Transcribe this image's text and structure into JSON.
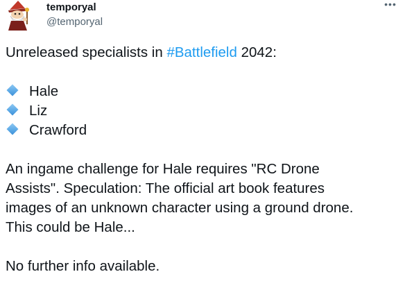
{
  "author": {
    "display_name": "temporyal",
    "handle": "@temporyal",
    "avatar_icon": "cartoon-wizard-avatar"
  },
  "more_icon": "more-horizontal-icon",
  "colors": {
    "hashtag": "#1d9bf0",
    "text": "#0f1419",
    "secondary": "#536471"
  },
  "tweet": {
    "intro_before": "Unreleased specialists in ",
    "hashtag": "#Battlefield",
    "intro_after": " 2042:",
    "bullet_icon": "small-blue-diamond-icon",
    "bullets": [
      "Hale",
      "Liz",
      "Crawford"
    ],
    "para_lines": [
      "An ingame challenge for Hale requires \"RC Drone",
      "Assists\". Speculation: The official art book features",
      "images of an unknown character using a ground drone.",
      "This could be Hale..."
    ],
    "closing": "No further info available."
  }
}
